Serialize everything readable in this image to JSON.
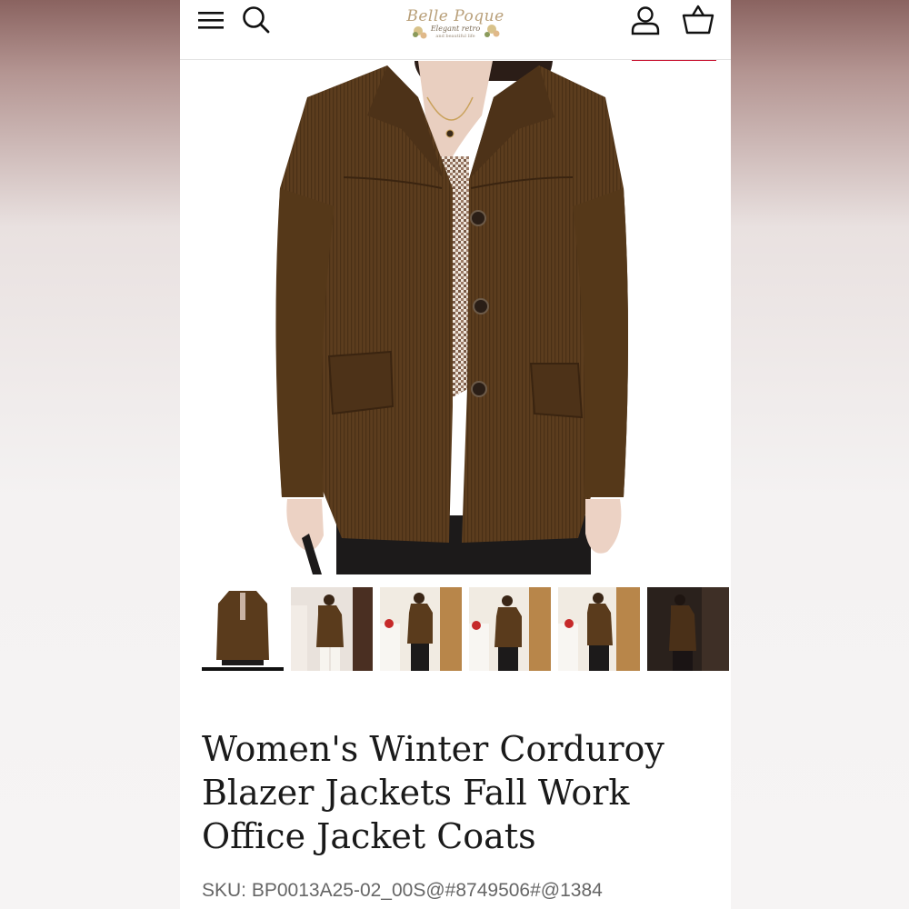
{
  "header": {
    "logo": {
      "name": "Belle Poque",
      "tagline": "Elegant retro",
      "sub_tagline": "and beautiful life"
    },
    "icons": [
      "menu-icon",
      "search-icon",
      "account-icon",
      "cart-icon"
    ]
  },
  "colors": {
    "sale_badge": "#c8102e",
    "jacket": "#5a3b1c",
    "active_thumb_underline": "#111111"
  },
  "gallery": {
    "thumbnail_count": 6,
    "active_index": 0
  },
  "product": {
    "title": "Women's Winter Corduroy Blazer Jackets Fall Work Office Jacket Coats",
    "sku_label": "SKU:",
    "sku_value": "BP0013A25-02_00S@#8749506#@1384"
  }
}
